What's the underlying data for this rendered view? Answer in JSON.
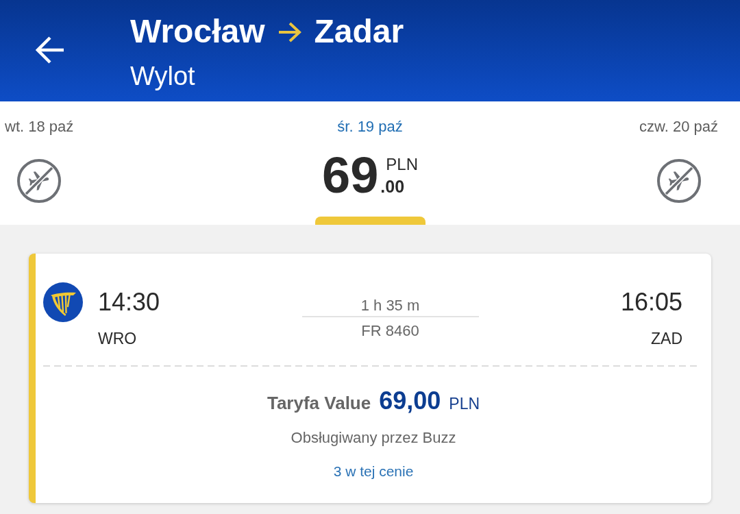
{
  "header": {
    "origin": "Wrocław",
    "destination": "Zadar",
    "subtitle": "Wylot"
  },
  "dates": [
    {
      "label": "wt. 18 paź",
      "selected": false,
      "kind": "unavailable"
    },
    {
      "label": "śr. 19 paź",
      "selected": true,
      "kind": "price",
      "price": {
        "amount": "69",
        "currency": "PLN",
        "decimals": ".00"
      }
    },
    {
      "label": "czw. 20 paź",
      "selected": false,
      "kind": "unavailable"
    }
  ],
  "flight": {
    "departure_time": "14:30",
    "departure_airport": "WRO",
    "duration": "1 h 35 m",
    "flight_number": "FR 8460",
    "arrival_time": "16:05",
    "arrival_airport": "ZAD",
    "fare_label": "Taryfa Value",
    "fare_price": "69,00",
    "fare_currency": "PLN",
    "operated_by": "Obsługiwany przez Buzz",
    "seats_at_price": "3 w tej cenie"
  }
}
